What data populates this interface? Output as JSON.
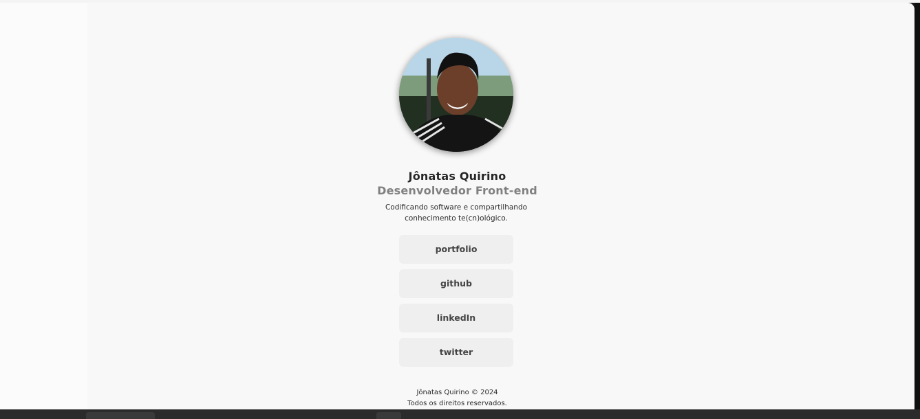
{
  "profile": {
    "name": "Jônatas Quirino",
    "role": "Desenvolvedor Front-end",
    "bio_line1": "Codificando software e compartilhando",
    "bio_line2": "conhecimento te(cn)ológico."
  },
  "links": [
    {
      "label": "portfolio"
    },
    {
      "label": "github"
    },
    {
      "label": "linkedIn"
    },
    {
      "label": "twitter"
    }
  ],
  "footer": {
    "copyright": "Jônatas Quirino © 2024",
    "rights": "Todos os direitos reservados."
  }
}
